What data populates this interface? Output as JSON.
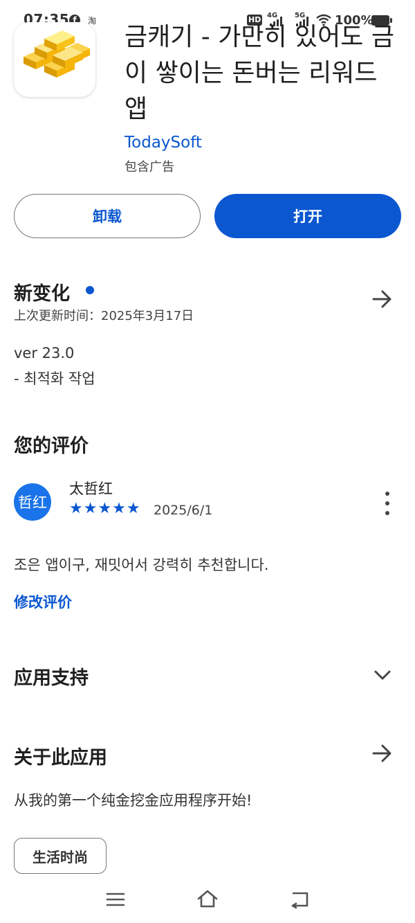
{
  "status_bar": {
    "time": "07:35",
    "notif_app_1": "f",
    "notif_app_2": "淘",
    "hd_label": "HD",
    "sim1_label": "4G",
    "sim2_label": "5G",
    "battery": "100%"
  },
  "app": {
    "title": "금캐기 - 가만히 있어도 금이 쌓이는 돈버는 리워드 앱",
    "developer": "TodaySoft",
    "ads_notice": "包含广告",
    "icon": "gold-bars-icon"
  },
  "actions": {
    "uninstall_label": "卸载",
    "open_label": "打开",
    "accent_color": "#0b57d0"
  },
  "whats_new": {
    "title": "新变化",
    "updated": "上次更新时间：2025年3月17日",
    "version": "ver 23.0",
    "note": "- 최적화 작업"
  },
  "your_review": {
    "title": "您的评价",
    "avatar_text": "哲红",
    "reviewer": "太哲红",
    "stars": "★★★★★",
    "rating": 5,
    "date": "2025/6/1",
    "text": "조은 앱이구, 재밋어서 강력히 추천합니다.",
    "edit_label": "修改评价"
  },
  "app_support": {
    "title": "应用支持"
  },
  "about": {
    "title": "关于此应用",
    "description": "从我的第一个纯金挖金应用程序开始!",
    "category_chip": "生活时尚"
  },
  "nav": {
    "icons": [
      "menu-icon",
      "home-icon",
      "back-icon"
    ]
  }
}
